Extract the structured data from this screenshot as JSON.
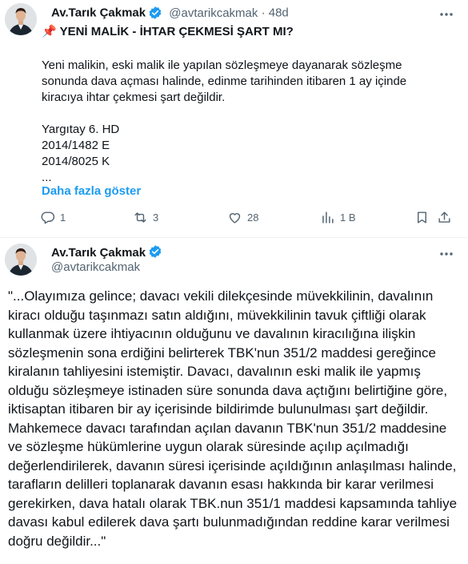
{
  "tweet1": {
    "author_name": "Av.Tarık Çakmak",
    "handle": "@avtarikcakmak",
    "separator": "·",
    "time": "48d",
    "title_emoji": "📌",
    "title": "YENİ MALİK - İHTAR ÇEKMESİ ŞART MI?",
    "body": "Yeni malikin, eski malik ile yapılan sözleşmeye dayanarak sözleşme sonunda dava açması halinde, edinme tarihinden itibaren 1 ay içinde kiracıya ihtar çekmesi şart değildir.\n\nYargıtay 6. HD\n2014/1482 E\n2014/8025 K\n...",
    "show_more": "Daha fazla göster",
    "actions": {
      "replies": "1",
      "retweets": "3",
      "likes": "28",
      "views": "1 B"
    }
  },
  "tweet2": {
    "author_name": "Av.Tarık Çakmak",
    "handle": "@avtarikcakmak",
    "body": "\"...Olayımıza gelince; davacı vekili dilekçesinde müvekkilinin, davalının kiracı olduğu taşınmazı satın aldığını, müvekkilinin tavuk çiftliği olarak kullanmak üzere ihtiyacının olduğunu ve davalının kiracılığına ilişkin sözleşmenin sona erdiğini belirterek TBK'nun 351/2 maddesi gereğince kiralanın tahliyesini istemiştir. Davacı, davalının eski malik ile yapmış olduğu sözleşmeye istinaden süre sonunda dava açtığını belirtiğine göre, iktisaptan itibaren bir ay içerisinde bildirimde bulunulması şart değildir. Mahkemece davacı tarafından açılan davanın TBK'nun 351/2 maddesine ve sözleşme hükümlerine uygun olarak süresinde açılıp açılmadığı değerlendirilerek, davanın süresi içerisinde açıldığının anlaşılması halinde, tarafların delilleri toplanarak davanın esası hakkında bir karar verilmesi gerekirken, dava hatalı olarak TBK.nun 351/1 maddesi kapsamında tahliye davası kabul edilerek dava şartı bulunmadığından reddine karar verilmesi doğru değildir...\""
  },
  "colors": {
    "text": "#0f1419",
    "muted": "#536471",
    "link": "#1d9bf0",
    "verified": "#1d9bf0"
  }
}
